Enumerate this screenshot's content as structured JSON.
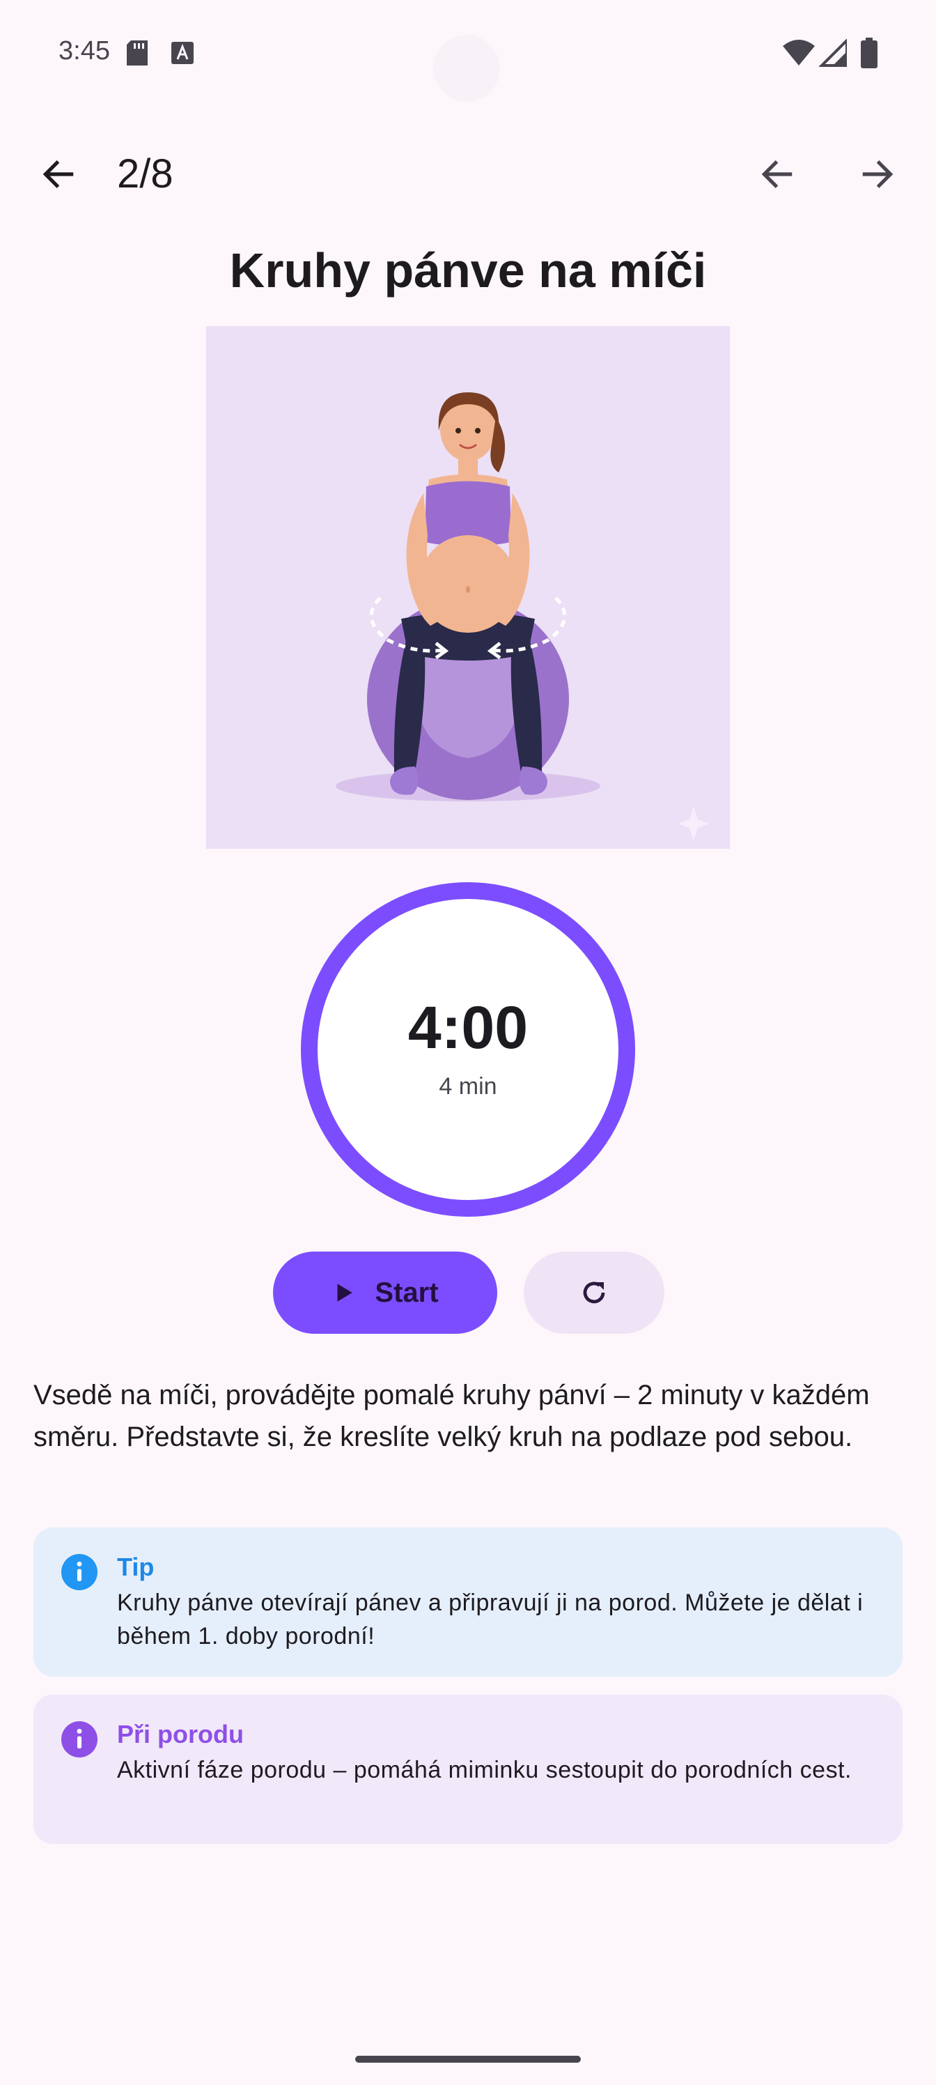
{
  "status_bar": {
    "time": "3:45"
  },
  "top_bar": {
    "progress": "2/8"
  },
  "exercise": {
    "title": "Kruhy pánve na míči",
    "description": "Vsedě na míči, provádějte pomalé kruhy pánví – 2 minuty v každém směru. Představte si, že kreslíte velký kruh na podlaze pod sebou."
  },
  "timer": {
    "value": "4:00",
    "subtitle": "4 min",
    "progress_fraction": 1.0
  },
  "controls": {
    "start_label": "Start"
  },
  "tip_card": {
    "title": "Tip",
    "text": "Kruhy pánve otevírají pánev a připravují ji na porod. Můžete je dělat i během 1. doby porodní!"
  },
  "birth_card": {
    "title": "Při porodu",
    "text": "Aktivní fáze porodu – pomáhá miminku sestoupit do porodních cest."
  },
  "colors": {
    "accent": "#7C4DFF",
    "tip_icon": "#2196F3",
    "tip_title": "#1E88E5",
    "birth_icon": "#8E4FE6",
    "birth_title": "#8E4FE6"
  },
  "icons": {
    "back": "arrow-left-icon",
    "prev": "arrow-left-icon",
    "next": "arrow-right-icon",
    "play": "play-icon",
    "reset": "refresh-icon",
    "info": "info-icon"
  }
}
